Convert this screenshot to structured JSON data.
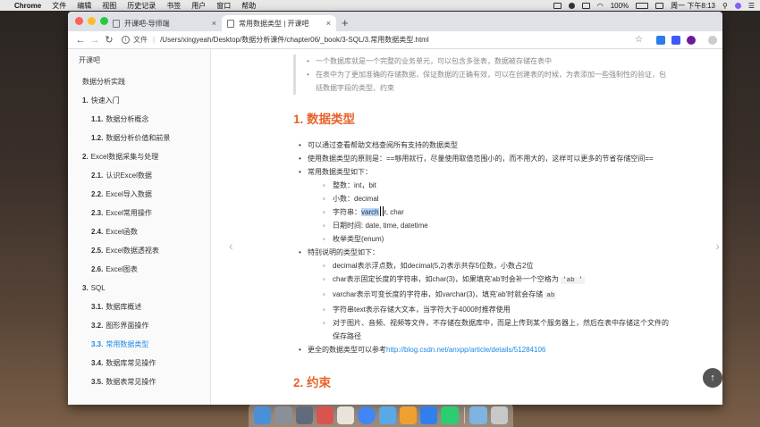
{
  "menubar": {
    "app": "Chrome",
    "items": [
      "文件",
      "编辑",
      "视图",
      "历史记录",
      "书签",
      "用户",
      "窗口",
      "帮助"
    ],
    "battery": "100%",
    "clock": "周一 下午8:13"
  },
  "browser": {
    "tabs": [
      {
        "title": "开课吧-导师端"
      },
      {
        "title": "常用数据类型 | 开课吧"
      }
    ],
    "new_tab": "+",
    "address": {
      "scheme_label": "文件",
      "url": "/Users/xingyeah/Desktop/数据分析课件/chapter06/_book/3-SQL/3.常用数据类型.html"
    },
    "ext_colors": [
      "#2b7de9",
      "#3d5afe",
      "#6a1b9a"
    ]
  },
  "sidebar": {
    "brand": "开课吧",
    "root": "数据分析实践",
    "items": [
      {
        "num": "1.",
        "label": "快速入门",
        "level": 1
      },
      {
        "num": "1.1.",
        "label": "数据分析概念",
        "level": 2
      },
      {
        "num": "1.2.",
        "label": "数据分析价值和前景",
        "level": 2
      },
      {
        "num": "2.",
        "label": "Excel数据采集与处理",
        "level": 1
      },
      {
        "num": "2.1.",
        "label": "认识Excel数据",
        "level": 2
      },
      {
        "num": "2.2.",
        "label": "Excel导入数据",
        "level": 2
      },
      {
        "num": "2.3.",
        "label": "Excel常用操作",
        "level": 2
      },
      {
        "num": "2.4.",
        "label": "Excel函数",
        "level": 2
      },
      {
        "num": "2.5.",
        "label": "Excel数据透视表",
        "level": 2
      },
      {
        "num": "2.6.",
        "label": "Excel图表",
        "level": 2
      },
      {
        "num": "3.",
        "label": "SQL",
        "level": 1
      },
      {
        "num": "3.1.",
        "label": "数据库概述",
        "level": 2
      },
      {
        "num": "3.2.",
        "label": "图形界面操作",
        "level": 2
      },
      {
        "num": "3.3.",
        "label": "常用数据类型",
        "level": 2
      },
      {
        "num": "3.4.",
        "label": "数据库常见操作",
        "level": 2
      },
      {
        "num": "3.5.",
        "label": "数据表常见操作",
        "level": 2
      }
    ],
    "active_index": 13
  },
  "article": {
    "quote": [
      "一个数据库就是一个完整的业务单元，可以包含多张表，数据被存储在表中",
      "在表中为了更加准确的存储数据，保证数据的正确有效，可以在创建表的时候，为表添加一些强制性的验证，包括数据字段的类型、约束"
    ],
    "h1": "1. 数据类型",
    "b1": "可以通过查看帮助文档查阅所有支持的数据类型",
    "b2": "使用数据类型的原则是：==够用就行，尽量使用取值范围小的，而不用大的，这样可以更多的节省存储空间==",
    "b3": "常用数据类型如下：",
    "common": {
      "int": "整数：int，bit",
      "dec": "小数：decimal",
      "str_prefix": "字符串：",
      "str_hl": "varch",
      "str_rest": "r, char",
      "date": "日期时间: date, time, datetime",
      "enum": "枚举类型(enum)"
    },
    "b4": "特别说明的类型如下：",
    "special": {
      "s1": "decimal表示浮点数，如decimal(5,2)表示共存5位数，小数占2位",
      "s2_text": "char表示固定长度的字符串，如char(3)，如果填充'ab'时会补一个空格为",
      "s2_code": "'ab '",
      "s3_text": "varchar表示可变长度的字符串，如varchar(3)，填充'ab'时就会存储",
      "s3_code": "ab",
      "s4": "字符串text表示存储大文本，当字符大于4000时推荐使用",
      "s5": "对于图片、音频、视频等文件，不存储在数据库中，而是上传到某个服务器上，然后在表中存储这个文件的保存路径"
    },
    "b5_text": "更全的数据类型可以参考",
    "b5_link": "http://blog.csdn.net/anxpp/article/details/51284106",
    "h2": "2. 约束"
  },
  "icons": {
    "back": "←",
    "forward": "→",
    "reload": "↻",
    "star": "☆",
    "prev_page": "‹",
    "next_page": "›",
    "scroll_top": "↑",
    "close": "×"
  },
  "dock_colors": [
    "#4a90d9",
    "#8a8f98",
    "#5f6b7a",
    "#d9534f",
    "#e8e4dc",
    "#4285f4",
    "#5aa9e6",
    "#f0a030",
    "#2f80ed",
    "#2ecc71",
    "#7fb3e0",
    "#c8c8c8"
  ]
}
